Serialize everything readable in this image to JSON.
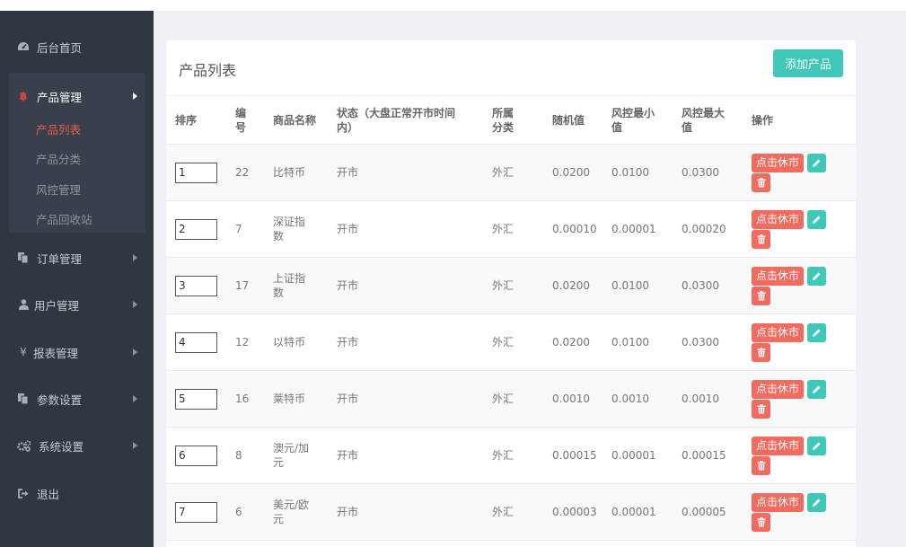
{
  "sidebar": {
    "items": [
      {
        "label": "后台首页",
        "icon": "dashboard-icon"
      },
      {
        "label": "产品管理",
        "icon": "bitcoin-icon"
      },
      {
        "label": "订单管理",
        "icon": "copy-icon"
      },
      {
        "label": "用户管理",
        "icon": "user-icon"
      },
      {
        "label": "报表管理",
        "icon": "yen-icon"
      },
      {
        "label": "参数设置",
        "icon": "copy-icon"
      },
      {
        "label": "系统设置",
        "icon": "gears-icon"
      },
      {
        "label": "退出",
        "icon": "sign-out-icon"
      }
    ],
    "subitems": [
      "产品列表",
      "产品分类",
      "风控管理",
      "产品回收站"
    ]
  },
  "panel": {
    "title": "产品列表",
    "add_button": "添加产品"
  },
  "table": {
    "headers": [
      "排序",
      "编号",
      "商品名称",
      "状态（大盘正常开市时间内）",
      "所属分类",
      "随机值",
      "风控最小值",
      "风控最大值",
      "操作"
    ],
    "rows": [
      {
        "sort": "1",
        "id": "22",
        "name": "比特币",
        "status": "开市",
        "category": "外汇",
        "random": "0.0200",
        "min": "0.0100",
        "max": "0.0300"
      },
      {
        "sort": "2",
        "id": "7",
        "name": "深证指数",
        "status": "开市",
        "category": "外汇",
        "random": "0.00010",
        "min": "0.00001",
        "max": "0.00020"
      },
      {
        "sort": "3",
        "id": "17",
        "name": "上证指数",
        "status": "开市",
        "category": "外汇",
        "random": "0.0200",
        "min": "0.0100",
        "max": "0.0300"
      },
      {
        "sort": "4",
        "id": "12",
        "name": "以特币",
        "status": "开市",
        "category": "外汇",
        "random": "0.0200",
        "min": "0.0100",
        "max": "0.0300"
      },
      {
        "sort": "5",
        "id": "16",
        "name": "莱特币",
        "status": "开市",
        "category": "外汇",
        "random": "0.0010",
        "min": "0.0010",
        "max": "0.0010"
      },
      {
        "sort": "6",
        "id": "8",
        "name": "澳元/加元",
        "status": "开市",
        "category": "外汇",
        "random": "0.00015",
        "min": "0.00001",
        "max": "0.00015"
      },
      {
        "sort": "7",
        "id": "6",
        "name": "美元/欧元",
        "status": "开市",
        "category": "外汇",
        "random": "0.00003",
        "min": "0.00001",
        "max": "0.00005"
      }
    ],
    "rest_button": "点击休市"
  },
  "colors": {
    "sidebar_bg": "#2f3741",
    "accent_teal": "#3dc8b8",
    "accent_red": "#f36a5e",
    "active_sub": "#f05a4f"
  }
}
